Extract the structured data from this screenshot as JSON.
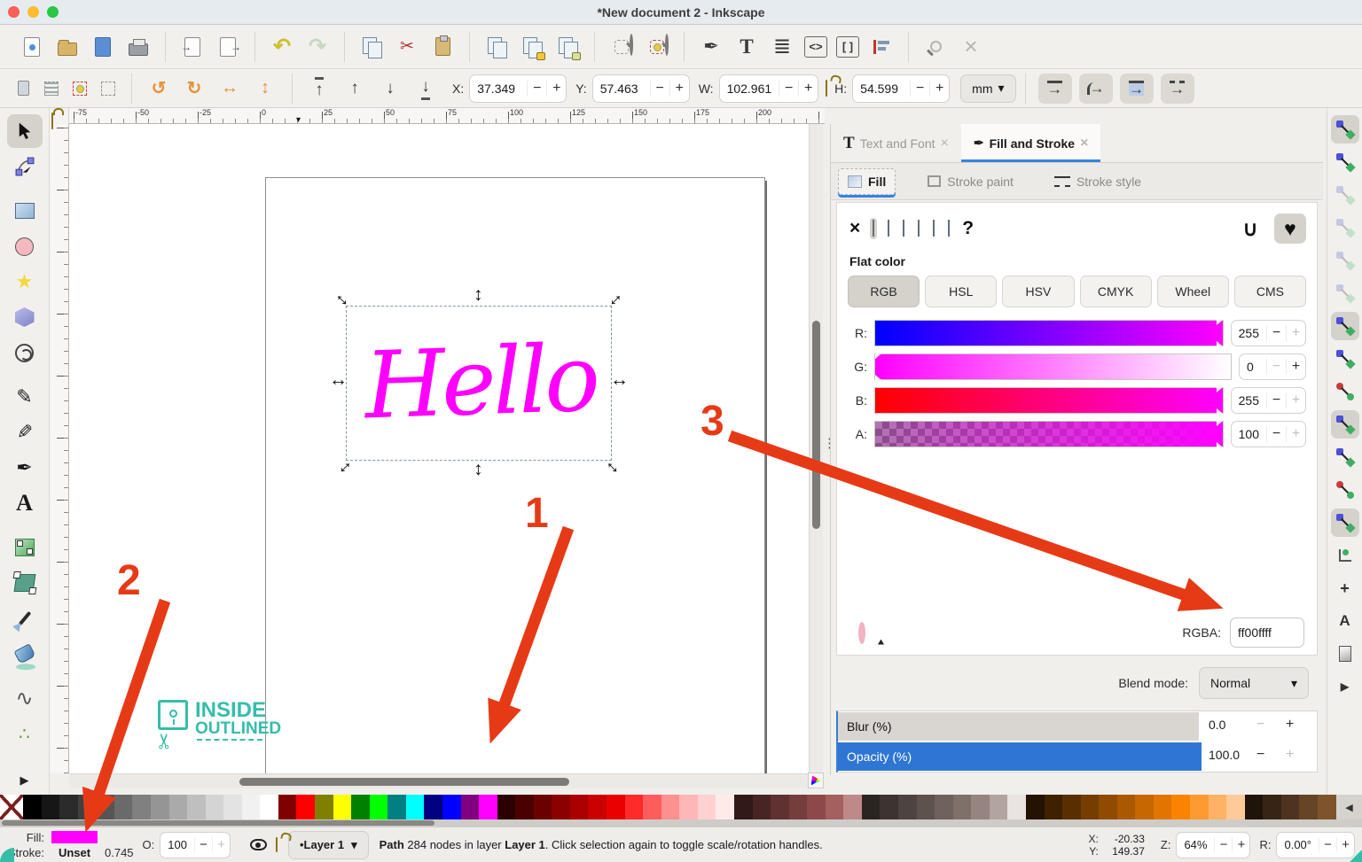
{
  "window": {
    "title": "*New document 2 - Inkscape"
  },
  "icons": {
    "undo": "↶",
    "redo": "↷",
    "cut": "✂",
    "text_T": "T",
    "layers": "≣",
    "xml": "<>",
    "braces": "[ ]",
    "wrench_x": "×",
    "rotate_ccw": "↺",
    "rotate_cw": "↻",
    "flip_h": "↔",
    "flip_v": "↕",
    "up": "↑",
    "down": "↓",
    "right_arrow": "→",
    "star": "★",
    "pencil": "✎",
    "calligraphy": "✎",
    "pen": "✒",
    "text_tool": "A",
    "wave": "∿",
    "spray": "∴",
    "expand": "▶",
    "collapse": "◀",
    "chevron": "▾",
    "close": "×",
    "question": "?",
    "none_x": "×",
    "fillrule_union": "∪",
    "fillrule_heart": "♥",
    "grip": "⋮",
    "marker": "▾",
    "plus": "+",
    "minus": "−",
    "scissors": "✂"
  },
  "toolbar_controls": {
    "x_label": "X:",
    "x": "37.349",
    "y_label": "Y:",
    "y": "57.463",
    "w_label": "W:",
    "w": "102.961",
    "h_label": "H:",
    "h": "54.599",
    "unit": "mm"
  },
  "ruler": {
    "h_labels": [
      "-75",
      "-50",
      "-25",
      "0",
      "25",
      "50",
      "75",
      "100",
      "125",
      "150",
      "175",
      "200"
    ]
  },
  "canvas": {
    "hello_text": "Hello",
    "logo": {
      "line1": "INSIDE",
      "line2": "OUTLINED"
    }
  },
  "annotations": {
    "labels": [
      "1",
      "2",
      "3"
    ],
    "color": "#e63a17"
  },
  "dock": {
    "tabs": [
      {
        "label": "Text and Font",
        "active": false
      },
      {
        "label": "Fill and Stroke",
        "active": true
      }
    ],
    "subtabs": [
      {
        "label": "Fill",
        "active": true
      },
      {
        "label": "Stroke paint",
        "active": false
      },
      {
        "label": "Stroke style",
        "active": false
      }
    ],
    "flat_color_label": "Flat color",
    "colorspace_tabs": [
      {
        "label": "RGB",
        "active": true
      },
      {
        "label": "HSL",
        "active": false
      },
      {
        "label": "HSV",
        "active": false
      },
      {
        "label": "CMYK",
        "active": false
      },
      {
        "label": "Wheel",
        "active": false
      },
      {
        "label": "CMS",
        "active": false
      }
    ],
    "sliders": [
      {
        "id": "r",
        "label": "R:",
        "value": "255",
        "pos": 1,
        "minus_active": true,
        "plus_active": false
      },
      {
        "id": "g",
        "label": "G:",
        "value": "0",
        "pos": 0,
        "minus_active": false,
        "plus_active": true
      },
      {
        "id": "b",
        "label": "B:",
        "value": "255",
        "pos": 1,
        "minus_active": true,
        "plus_active": false
      },
      {
        "id": "a",
        "label": "A:",
        "value": "100",
        "pos": 1,
        "minus_active": true,
        "plus_active": false
      }
    ],
    "rgba_label": "RGBA:",
    "rgba_value": "ff00ffff",
    "blend_label": "Blend mode:",
    "blend_value": "Normal",
    "blur_label": "Blur (%)",
    "blur_value": "0.0",
    "opacity_label": "Opacity (%)",
    "opacity_value": "100.0"
  },
  "snap_items": [
    {
      "name": "snap-toggle",
      "pressed": true
    },
    {
      "name": "snap-bounding-box"
    },
    {
      "name": "snap-bbox-edges",
      "disabled": true
    },
    {
      "name": "snap-bbox-corners",
      "disabled": true
    },
    {
      "name": "snap-bbox-edge-midpoints",
      "disabled": true
    },
    {
      "name": "snap-bbox-centers",
      "disabled": true
    },
    {
      "name": "snap-nodes",
      "pressed": true
    },
    {
      "name": "snap-paths"
    },
    {
      "name": "snap-path-intersections",
      "variant": "red"
    },
    {
      "name": "snap-cusp-nodes",
      "pressed": true
    },
    {
      "name": "snap-smooth-nodes"
    },
    {
      "name": "snap-line-midpoints",
      "variant": "red"
    },
    {
      "name": "snap-others",
      "pressed": true
    },
    {
      "name": "snap-object-centers",
      "variant": "corner"
    },
    {
      "name": "snap-rotation-centers",
      "variant": "plus"
    },
    {
      "name": "snap-text-baseline",
      "variant": "A"
    },
    {
      "name": "snap-page-border",
      "variant": "page"
    },
    {
      "name": "toolbar-expand",
      "variant": "right"
    }
  ],
  "palette": {
    "colors": [
      "#000000",
      "#161616",
      "#2b2b2b",
      "#404040",
      "#555555",
      "#6a6a6a",
      "#808080",
      "#959595",
      "#aaaaaa",
      "#bfbfbf",
      "#d4d4d4",
      "#e3e3e3",
      "#f1f1f1",
      "#ffffff",
      "#800000",
      "#ff0000",
      "#808000",
      "#ffff00",
      "#008000",
      "#00ff00",
      "#008080",
      "#00ffff",
      "#000080",
      "#0000ff",
      "#800080",
      "#ff00ff",
      "#2b0000",
      "#4b0000",
      "#6b0000",
      "#8b0000",
      "#ab0000",
      "#cb0000",
      "#eb0000",
      "#ff2a2a",
      "#ff5d5d",
      "#ff9090",
      "#ffb6b6",
      "#ffd2d2",
      "#ffeaea",
      "#311919",
      "#482525",
      "#5f3131",
      "#763d3d",
      "#8d4949",
      "#a45f5f",
      "#c08989",
      "#2b2522",
      "#3c3431",
      "#4d4340",
      "#5e524e",
      "#6f615c",
      "#80706a",
      "#968480",
      "#b2a49f",
      "#e9e4e1",
      "#241300",
      "#3f2100",
      "#5a2f00",
      "#753d00",
      "#904b00",
      "#ab5900",
      "#c66700",
      "#e17500",
      "#fc8300",
      "#ff9a33",
      "#ffb266",
      "#ffca99",
      "#1e140a",
      "#362415",
      "#4e3420",
      "#664426",
      "#7e542c"
    ]
  },
  "statusbar": {
    "fill_label": "Fill:",
    "stroke_label": "Stroke:",
    "stroke_value": "Unset",
    "stroke_width": "0.745",
    "opacity_label": "O:",
    "opacity_value": "100",
    "layer_button": "•Layer 1",
    "message": {
      "b1": "Path",
      "t1": " 284 nodes in layer ",
      "b2": "Layer 1",
      "t2": ". Click selection again to toggle scale/rotation handles."
    },
    "x_label": "X:",
    "x": "-20.33",
    "y_label": "Y:",
    "y": "149.37",
    "z_label": "Z:",
    "zoom": "64%",
    "r_label": "R:",
    "rotation": "0.00°"
  }
}
